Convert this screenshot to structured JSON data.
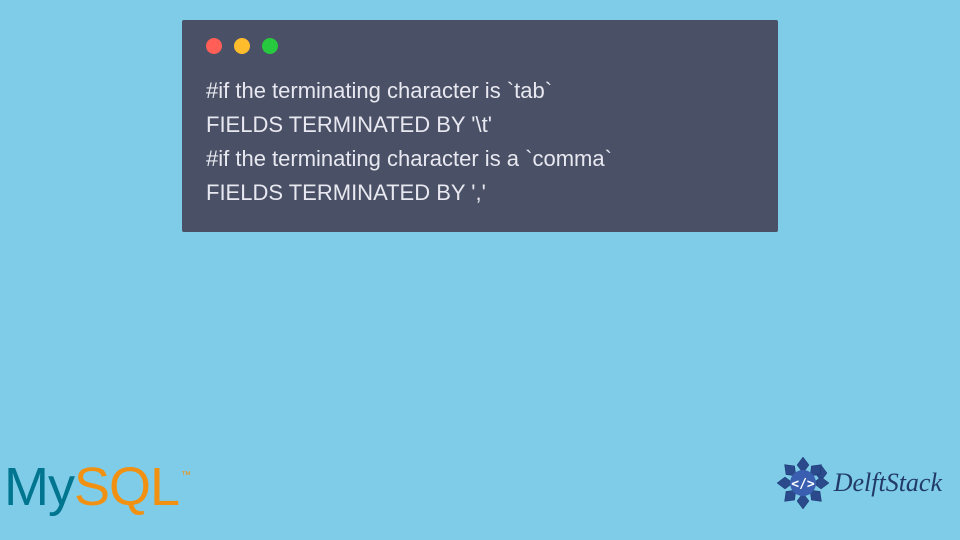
{
  "codeWindow": {
    "dots": [
      "red",
      "yellow",
      "green"
    ],
    "lines": [
      "#if the terminating character is `tab`",
      "FIELDS TERMINATED BY '\\t'",
      "#if the terminating character is a `comma`",
      "FIELDS TERMINATED BY ','"
    ]
  },
  "logos": {
    "mysql": {
      "my": "My",
      "sql": "SQL",
      "tm": "™"
    },
    "delft": {
      "text": "DelftStack"
    }
  },
  "colors": {
    "background": "#7ecce8",
    "window": "#4a5066",
    "codeText": "#e8e8f0",
    "mysqlMy": "#00758f",
    "mysqlSql": "#f29111",
    "delftBlue": "#223a66"
  }
}
